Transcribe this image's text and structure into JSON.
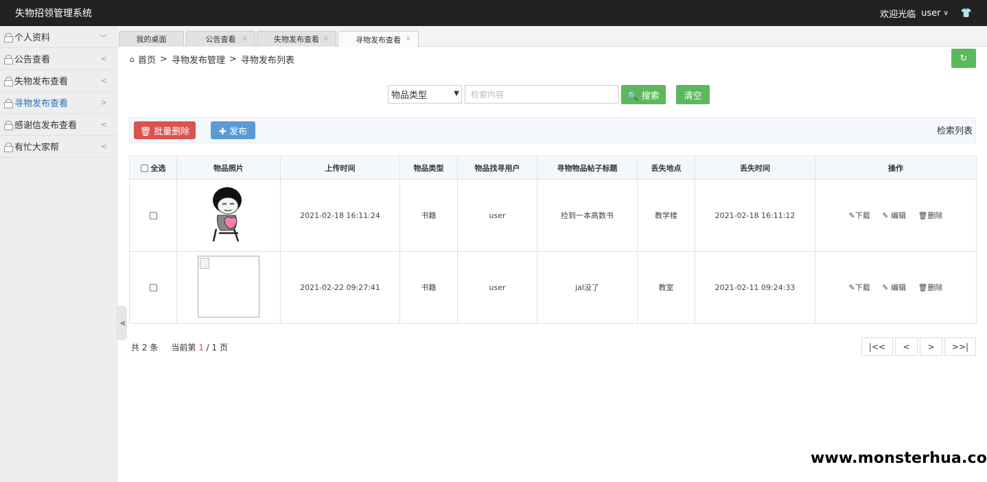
{
  "header": {
    "app_title": "失物招领管理系统",
    "welcome": "欢迎光临",
    "user": "user",
    "caret": "∨",
    "shirt_icon": "👕"
  },
  "sidebar": {
    "items": [
      {
        "label": "个人资料",
        "arrow": "﹀",
        "active": false
      },
      {
        "label": "公告查看",
        "arrow": "<",
        "active": false
      },
      {
        "label": "失物发布查看",
        "arrow": "<",
        "active": false
      },
      {
        "label": "寻物发布查看",
        "arrow": ">",
        "active": true
      },
      {
        "label": "感谢信发布查看",
        "arrow": "<",
        "active": false
      },
      {
        "label": "有忙大家帮",
        "arrow": "<",
        "active": false
      }
    ],
    "collapse_icon": "◀"
  },
  "tabs": [
    {
      "label": "我的桌面"
    },
    {
      "label": "公告查看",
      "close": "×"
    },
    {
      "label": "失物发布查看",
      "close": "×"
    },
    {
      "label": "寻物发布查看",
      "close": "×",
      "active": true
    }
  ],
  "breadcrumb": {
    "home": "首页",
    "sep": ">",
    "level2": "寻物发布管理",
    "level3": "寻物发布列表",
    "home_icon": "⌂"
  },
  "refresh_icon": "↻",
  "search": {
    "selected": "物品类型",
    "dropdown_icon": "▼",
    "placeholder": "检索内容",
    "search_label": "🔍 搜索",
    "clear_label": "清空"
  },
  "toolbar": {
    "batch_delete_label": "🗑 批量删除",
    "publish_label": "✚ 发布",
    "right_label": "检索列表"
  },
  "table": {
    "select_all": "全选",
    "columns": [
      "物品照片",
      "上传时间",
      "物品类型",
      "物品找寻用户",
      "寻物物品帖子标题",
      "丢失地点",
      "丢失时间",
      "操作"
    ],
    "rows": [
      {
        "upload_time": "2021-02-18 16:11:24",
        "type": "书籍",
        "user": "user",
        "title": "捡到一本高数书",
        "place": "教学楼",
        "lost_time": "2021-02-18 16:11:12"
      },
      {
        "upload_time": "2021-02-22 09:27:41",
        "type": "书籍",
        "user": "user",
        "title": "jal没了",
        "place": "教室",
        "lost_time": "2021-02-11 09:24:33"
      }
    ],
    "ops": {
      "download": "✎下载",
      "edit": "✎ 编辑",
      "delete": "🗑删除"
    }
  },
  "pagination": {
    "total": "共 2 条",
    "current_prefix": "当前第",
    "current": "1",
    "of": "/ 1 页",
    "first": "|<<",
    "prev": "<",
    "next": ">",
    "last": ">>|"
  },
  "watermark": "www.monsterhua.com"
}
